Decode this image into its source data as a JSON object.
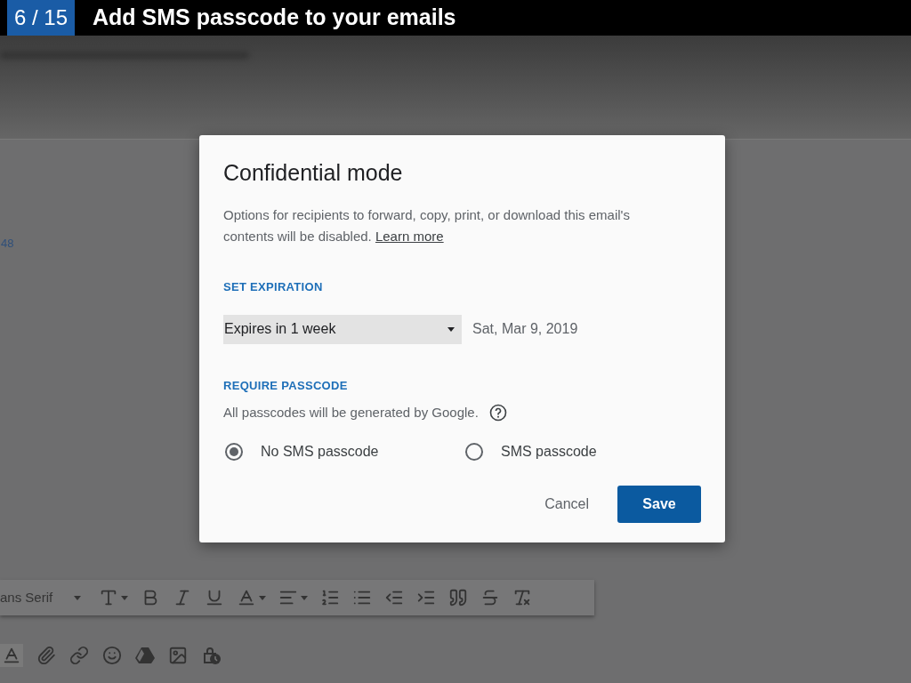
{
  "banner": {
    "step": "6 / 15",
    "title": "Add SMS passcode to your emails"
  },
  "background": {
    "side_text": "48"
  },
  "dialog": {
    "title": "Confidential mode",
    "description": "Options for recipients to forward, copy, print, or download this email's contents will be disabled.",
    "link": "Learn more",
    "expiration": {
      "heading": "SET EXPIRATION",
      "value": "Expires in 1 week",
      "date": "Sat, Mar 9, 2019"
    },
    "passcode": {
      "heading": "REQUIRE PASSCODE",
      "note": "All passcodes will be generated by Google.",
      "options": [
        {
          "label": "No SMS passcode",
          "selected": true
        },
        {
          "label": "SMS passcode",
          "selected": false
        }
      ]
    },
    "buttons": {
      "cancel": "Cancel",
      "save": "Save"
    }
  },
  "format_toolbar": {
    "font": "ans Serif"
  }
}
